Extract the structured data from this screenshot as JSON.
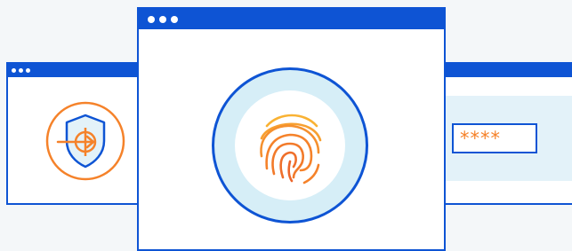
{
  "windows": {
    "left": {
      "icon": "shield-login-icon"
    },
    "center": {
      "icon": "fingerprint-icon"
    },
    "right": {
      "password_mask": "****"
    }
  },
  "colors": {
    "window_frame": "#0e54d4",
    "accent_orange": "#f5822a",
    "light_blue": "#d6eef7",
    "background": "#f4f7f9"
  }
}
